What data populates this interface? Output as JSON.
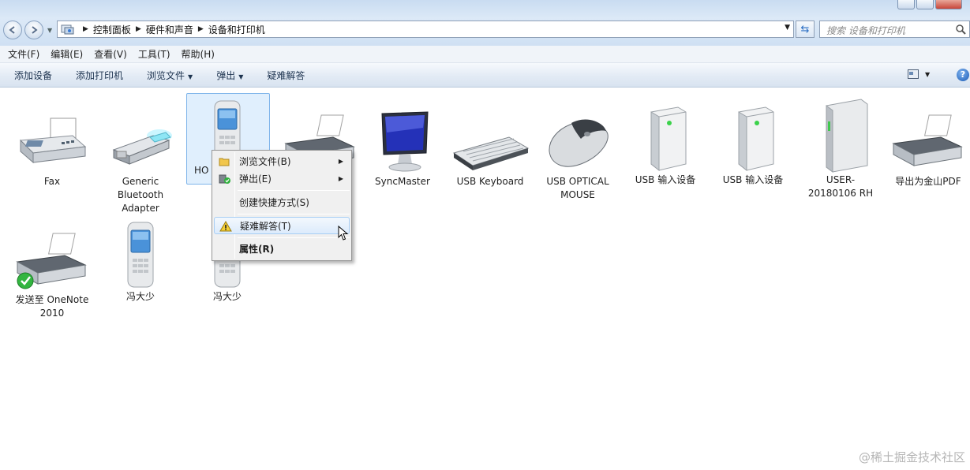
{
  "addressbar": {
    "crumbs": [
      "控制面板",
      "硬件和声音",
      "设备和打印机"
    ],
    "search_placeholder": "搜索 设备和打印机"
  },
  "menubar": [
    "文件(F)",
    "编辑(E)",
    "查看(V)",
    "工具(T)",
    "帮助(H)"
  ],
  "commandbar": {
    "add_device": "添加设备",
    "add_printer": "添加打印机",
    "browse_files": "浏览文件",
    "eject": "弹出",
    "troubleshoot": "疑难解答"
  },
  "devices": [
    {
      "label": "Fax",
      "icon": "fax-icon"
    },
    {
      "label": "Generic Bluetooth Adapter",
      "icon": "bluetooth-adapter-icon"
    },
    {
      "label": "HO",
      "icon": "phone-icon"
    },
    {
      "label": "",
      "icon": "printer-icon"
    },
    {
      "label": "SyncMaster",
      "icon": "monitor-icon"
    },
    {
      "label": "USB Keyboard",
      "icon": "keyboard-icon"
    },
    {
      "label": "USB OPTICAL MOUSE",
      "icon": "mouse-icon"
    },
    {
      "label": "USB 输入设备",
      "icon": "usb-device-icon"
    },
    {
      "label": "USB 输入设备",
      "icon": "usb-device-icon"
    },
    {
      "label": "USER-20180106 RH",
      "icon": "computer-icon"
    },
    {
      "label": "导出为金山PDF",
      "icon": "printer-icon"
    },
    {
      "label": "发送至 OneNote 2010",
      "icon": "printer-default-icon"
    },
    {
      "label": "冯大少",
      "icon": "phone-icon"
    },
    {
      "label": "冯大少",
      "icon": "phone-icon"
    }
  ],
  "context_menu": {
    "browse_files": "浏览文件(B)",
    "eject": "弹出(E)",
    "create_shortcut": "创建快捷方式(S)",
    "troubleshoot": "疑难解答(T)",
    "properties": "属性(R)"
  },
  "watermark": "@稀土掘金技术社区",
  "colors": {
    "accent": "#2c6fc4",
    "selection": "#cce4fc",
    "toolbar": "#dce7f4"
  }
}
